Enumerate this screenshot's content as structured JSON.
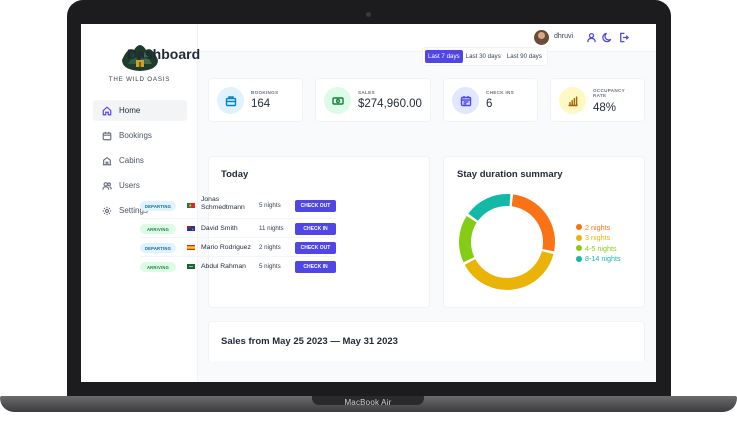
{
  "device": {
    "label": "MacBook Air"
  },
  "sidebar": {
    "brand": "THE WILD OASIS",
    "items": [
      {
        "label": "Home",
        "icon": "home-icon",
        "active": true
      },
      {
        "label": "Bookings",
        "icon": "calendar-icon",
        "active": false
      },
      {
        "label": "Cabins",
        "icon": "cabin-icon",
        "active": false
      },
      {
        "label": "Users",
        "icon": "users-icon",
        "active": false
      },
      {
        "label": "Settings",
        "icon": "gear-icon",
        "active": false
      }
    ]
  },
  "header": {
    "username": "dhruvi"
  },
  "main": {
    "title": "Dashboard",
    "filters": [
      "Last 7 days",
      "Last 30 days",
      "Last 90 days"
    ],
    "active_filter": "Last 7 days",
    "stats": [
      {
        "label": "BOOKINGS",
        "value": "164",
        "color": "#0284c7",
        "bg": "#e0f2fe",
        "icon": "briefcase-icon"
      },
      {
        "label": "SALES",
        "value": "$274,960.00",
        "color": "#15803d",
        "bg": "#dcfce7",
        "icon": "banknote-icon"
      },
      {
        "label": "CHECK INS",
        "value": "6",
        "color": "#4f46e5",
        "bg": "#e0e7ff",
        "icon": "calendar-days-icon"
      },
      {
        "label_line1": "OCCUPANCY",
        "label_line2": "RATE",
        "value": "48%",
        "color": "#a16207",
        "bg": "#fef9c3",
        "icon": "bar-chart-icon"
      }
    ],
    "today": {
      "title": "Today",
      "rows": [
        {
          "status": "DEPARTING",
          "name_line1": "Jonas",
          "name_line2": "Schmedtmann",
          "nights": "5 nights",
          "action": "CHECK OUT",
          "flag": "pt"
        },
        {
          "status": "ARRIVING",
          "name_line1": "David Smith",
          "name_line2": "",
          "nights": "11 nights",
          "action": "CHECK IN",
          "flag": "au"
        },
        {
          "status": "DEPARTING",
          "name_line1": "Mario Rodriguez",
          "name_line2": "",
          "nights": "2 nights",
          "action": "CHECK OUT",
          "flag": "es"
        },
        {
          "status": "ARRIVING",
          "name_line1": "Abdul Rahman",
          "name_line2": "",
          "nights": "5 nights",
          "action": "CHECK IN",
          "flag": "sa"
        }
      ]
    },
    "duration": {
      "title": "Stay duration summary",
      "segments": [
        {
          "label": "2 nights",
          "value": 0.27,
          "color": "#f97316"
        },
        {
          "label": "3 nights",
          "value": 0.39,
          "color": "#eab308"
        },
        {
          "label": "4-5 nights",
          "value": 0.17,
          "color": "#84cc16"
        },
        {
          "label": "8-14 nights",
          "value": 0.17,
          "color": "#14b8a6"
        }
      ]
    },
    "sales_title": "Sales from May 25 2023 — May 31 2023"
  }
}
